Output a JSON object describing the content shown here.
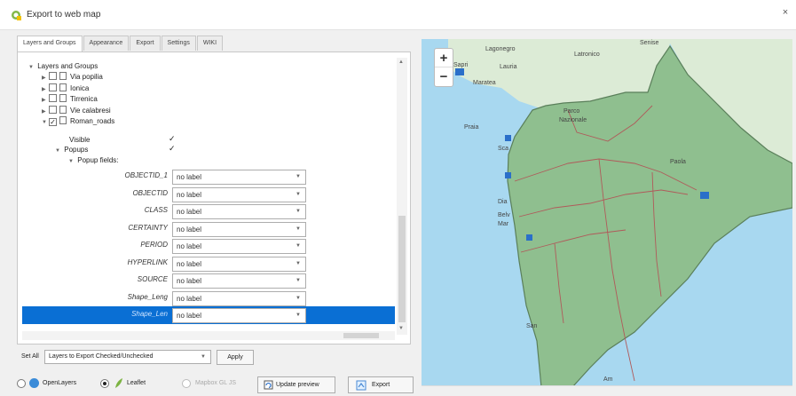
{
  "window": {
    "title": "Export to web map",
    "close_glyph": "×"
  },
  "tabs": [
    {
      "label": "Layers and Groups",
      "active": true
    },
    {
      "label": "Appearance",
      "active": false
    },
    {
      "label": "Export",
      "active": false
    },
    {
      "label": "Settings",
      "active": false
    },
    {
      "label": "WIKI",
      "active": false
    }
  ],
  "tree": {
    "root_label": "Layers and Groups",
    "layers": [
      {
        "label": "Via popilia",
        "checked": false
      },
      {
        "label": "Ionica",
        "checked": false
      },
      {
        "label": "Tirrenica",
        "checked": false
      },
      {
        "label": "Vie calabresi",
        "checked": false
      },
      {
        "label": "Roman_roads",
        "checked": true
      }
    ],
    "visible_label": "Visible",
    "popups_label": "Popups",
    "popup_fields_label": "Popup fields:",
    "check_glyph": "✓"
  },
  "fields": [
    {
      "name": "OBJECTID_1",
      "value": "no label"
    },
    {
      "name": "OBJECTID",
      "value": "no label"
    },
    {
      "name": "CLASS",
      "value": "no label"
    },
    {
      "name": "CERTAINTY",
      "value": "no label"
    },
    {
      "name": "PERIOD",
      "value": "no label"
    },
    {
      "name": "HYPERLINK",
      "value": "no label"
    },
    {
      "name": "SOURCE",
      "value": "no label"
    },
    {
      "name": "Shape_Leng",
      "value": "no label"
    },
    {
      "name": "Shape_Len",
      "value": "no label",
      "selected": true
    }
  ],
  "set_all": {
    "label": "Set All",
    "select_value": "Layers to Export Checked/Unchecked",
    "apply_label": "Apply"
  },
  "bottom": {
    "openlayers_label": "OpenLayers",
    "leaflet_label": "Leaflet",
    "mapbox_label": "Mapbox GL JS",
    "update_preview_label": "Update preview",
    "export_label": "Export",
    "selected_renderer": "Leaflet"
  },
  "map": {
    "zoom_in": "+",
    "zoom_out": "−",
    "labels": [
      "Lagonegro",
      "Senise",
      "Sapri",
      "Latronico",
      "Lauria",
      "Maratea",
      "Parco",
      "Nazionale",
      "Praia",
      "Sca",
      "Dia",
      "Belv",
      "Mar",
      "Paola",
      "San",
      "Am"
    ],
    "colors": {
      "sea": "#a8d8f0",
      "land_region": "#8fbf8f",
      "road": "#b05a5a"
    }
  }
}
